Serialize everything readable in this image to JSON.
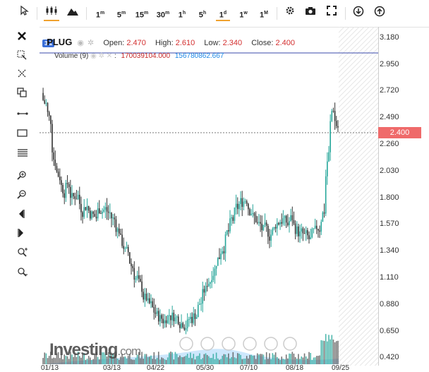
{
  "toolbar": {
    "cursor_icon": "cursor-icon",
    "candles_icon": "candles-icon",
    "mountain_icon": "mountain-icon",
    "intervals": [
      "1m",
      "5m",
      "15m",
      "30m",
      "1h",
      "5h",
      "1d",
      "1w",
      "1M"
    ],
    "active_interval": "1d",
    "settings_icon": "gear-icon",
    "camera_icon": "camera-icon",
    "fullscreen_icon": "fullscreen-icon",
    "download_icon": "download-icon",
    "upload_icon": "upload-icon"
  },
  "legend": {
    "symbol_badge": "3.1",
    "name": "PLUG",
    "open_label": "Open:",
    "open": "2.470",
    "high_label": "High:",
    "high": "2.610",
    "low_label": "Low:",
    "low": "2.340",
    "close_label": "Close:",
    "close": "2.400",
    "volume_label": "Volume (9)",
    "volume_val1": "170039104.000",
    "volume_val2": "156780862.667"
  },
  "current_price": "2.400",
  "watermark": {
    "brand": "Investing",
    "suffix": ".com"
  },
  "sidebar_icons": [
    "close-icon",
    "crosshair-icon",
    "magnet-icon",
    "copy-icon",
    "trendline-icon",
    "rectangle-icon",
    "fib-icon",
    "zoom-in-icon",
    "zoom-out-icon",
    "scroll-left-icon",
    "scroll-right-icon",
    "zoom-reset-icon",
    "zoom-fit-icon"
  ],
  "chart_data": {
    "type": "candlestick",
    "symbol": "PLUG",
    "y_ticks": [
      "3.180",
      "2.950",
      "2.720",
      "2.490",
      "2.260",
      "2.030",
      "1.800",
      "1.570",
      "1.340",
      "1.110",
      "0.880",
      "0.650",
      "0.420"
    ],
    "x_ticks": [
      "01/13",
      "03/13",
      "04/22",
      "05/30",
      "07/10",
      "08/18",
      "09/25"
    ],
    "ylim": [
      0.35,
      3.27
    ],
    "close_series": [
      2.6,
      2.45,
      2.1,
      1.98,
      1.86,
      1.92,
      1.78,
      1.83,
      1.7,
      1.74,
      1.66,
      1.62,
      1.72,
      1.7,
      1.66,
      1.6,
      1.52,
      1.38,
      1.3,
      1.2,
      1.1,
      1.0,
      0.92,
      0.85,
      0.8,
      0.76,
      0.74,
      0.8,
      0.78,
      0.76,
      0.74,
      0.72,
      0.76,
      0.8,
      0.9,
      1.0,
      1.1,
      1.2,
      1.3,
      1.4,
      1.5,
      1.6,
      1.7,
      1.76,
      1.8,
      1.7,
      1.6,
      1.55,
      1.5,
      1.48,
      1.52,
      1.6,
      1.62,
      1.56,
      1.62,
      1.52,
      1.48,
      1.45,
      1.42,
      1.48,
      1.55,
      1.7,
      2.2,
      2.6,
      2.4
    ],
    "volume_note": "volume bars"
  }
}
